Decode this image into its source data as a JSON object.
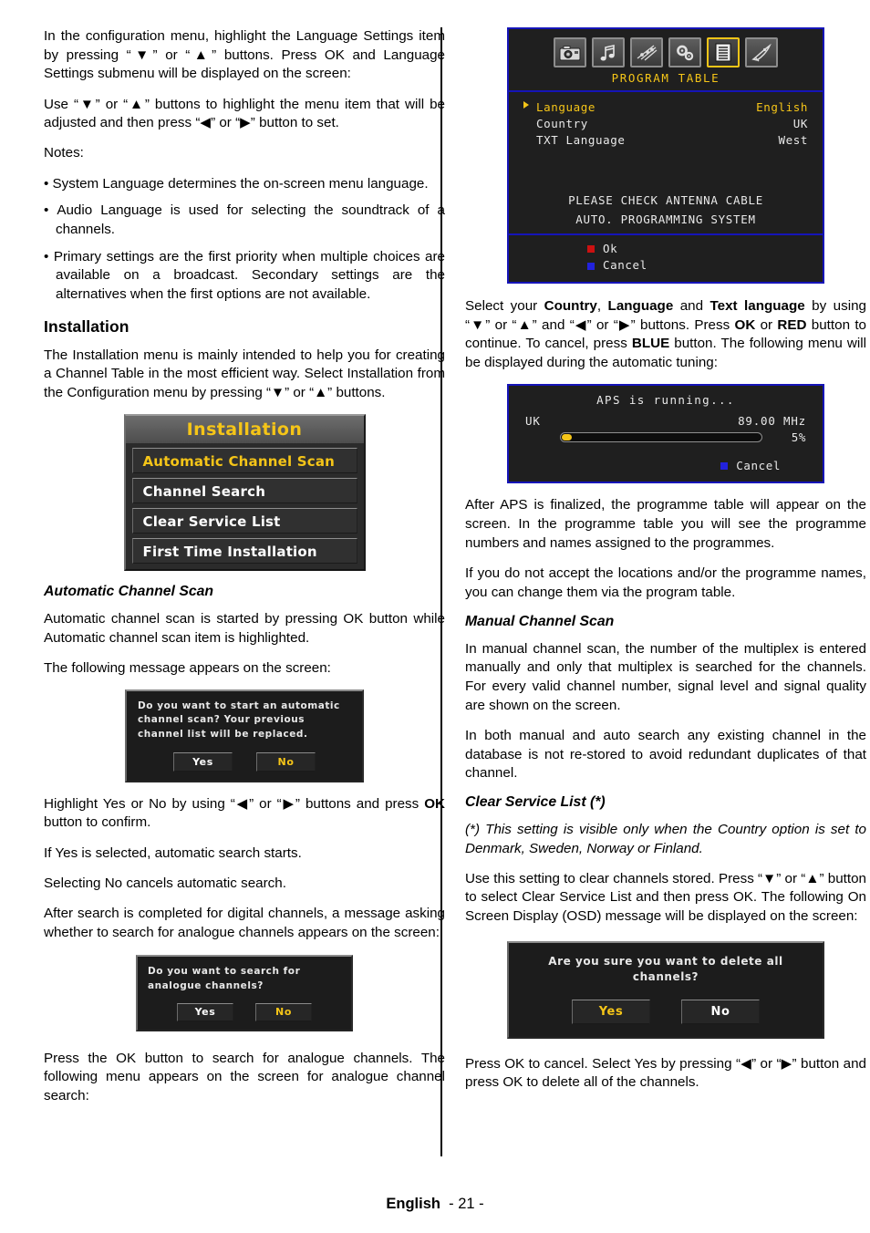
{
  "left_column": {
    "p1": "In the configuration menu, highlight the Language Settings item by pressing “▼” or “▲” buttons. Press OK and Language Settings submenu will be displayed on the screen:",
    "p2": "Use “▼” or “▲” buttons to highlight the menu item that will be adjusted and then press “◀” or “▶” button to set.",
    "notes_label": "Notes:",
    "notes": [
      "System Language determines the on-screen menu language.",
      "Audio Language is used for selecting the soundtrack of a channels.",
      "Primary settings are the first priority when multiple choices are available on a broadcast. Secondary settings are the alternatives when the first options are not available."
    ],
    "installation_heading": "Installation",
    "p3": "The Installation menu is mainly intended to help you for creating a Channel Table in the most efficient way. Select Installation from the Configuration menu by pressing “▼” or “▲” buttons.",
    "installation_menu": {
      "title": "Installation",
      "items": [
        {
          "label": "Automatic Channel Scan",
          "highlighted": true
        },
        {
          "label": "Channel Search",
          "highlighted": false
        },
        {
          "label": "Clear Service List",
          "highlighted": false
        },
        {
          "label": "First Time Installation",
          "highlighted": false
        }
      ]
    },
    "auto_scan_heading": "Automatic Channel Scan",
    "p4": "Automatic channel scan is started by pressing OK button while Automatic channel scan item is highlighted.",
    "p5": "The following message appears on the screen:",
    "dialog_auto_scan": {
      "message": "Do you want to start an automatic channel scan? Your previous channel list will be replaced.",
      "buttons": [
        {
          "label": "Yes",
          "highlighted": false
        },
        {
          "label": "No",
          "highlighted": true
        }
      ]
    },
    "p6_pre": "Highlight Yes or No by using “◀” or “▶” buttons and press ",
    "p6_bold": "OK",
    "p6_post": " button to confirm.",
    "p7": "If Yes is selected, automatic search starts.",
    "p8": "Selecting No cancels automatic search.",
    "p9": "After search is completed for digital channels, a message asking whether to search for analogue channels appears on the screen:",
    "dialog_analogue": {
      "message": "Do you want to search for analogue channels?",
      "buttons": [
        {
          "label": "Yes",
          "highlighted": false
        },
        {
          "label": "No",
          "highlighted": true
        }
      ]
    },
    "p10": "Press the OK button to search for analogue channels. The following menu appears on the screen for analogue channel search:"
  },
  "right_column": {
    "program_table_osd": {
      "tabs": [
        {
          "icon": "camera-icon",
          "active": false
        },
        {
          "icon": "music-note-icon",
          "active": false
        },
        {
          "icon": "feature-sliders-icon",
          "active": false
        },
        {
          "icon": "gears-icon",
          "active": false
        },
        {
          "icon": "list-document-icon",
          "active": true
        },
        {
          "icon": "install-rocket-icon",
          "active": false
        }
      ],
      "tab_label": "PROGRAM TABLE",
      "rows": [
        {
          "label": "Language",
          "value": "English",
          "highlighted": true
        },
        {
          "label": "Country",
          "value": "UK",
          "highlighted": false
        },
        {
          "label": "TXT Language",
          "value": "West",
          "highlighted": false
        }
      ],
      "notice_line1": "PLEASE CHECK ANTENNA CABLE",
      "notice_line2": "AUTO. PROGRAMMING SYSTEM",
      "footer_actions": [
        {
          "color": "#cc1111",
          "label": "Ok"
        },
        {
          "color": "#2222dd",
          "label": "Cancel"
        }
      ]
    },
    "p1_parts": {
      "a": "Select your ",
      "b1": "Country",
      "c": ", ",
      "b2": "Language",
      "d": " and ",
      "b3": "Text language",
      "e": " by using “▼” or “▲”  and  “◀” or “▶” buttons. Press ",
      "b4": "OK",
      "f": " or ",
      "b5": "RED",
      "g": " button to continue. To cancel, press ",
      "b6": "BLUE",
      "h": " button. The following menu will be displayed during the automatic tuning:"
    },
    "aps_osd": {
      "title": "APS is running...",
      "country": "UK",
      "frequency": "89.00 MHz",
      "percent": "5%",
      "progress_value": 5,
      "cancel_label": "Cancel",
      "cancel_color": "#2222dd"
    },
    "p2": "After APS is finalized, the programme table will appear on the screen. In the programme table you will see the programme numbers and names assigned to the programmes.",
    "p3": "If you do not accept the locations and/or the programme names, you can change them via the program table.",
    "manual_scan_heading": "Manual Channel Scan",
    "p4": "In manual channel scan, the number of the multiplex is entered manually and only that multiplex is searched for the channels. For every valid channel number, signal level and signal quality are shown on the screen.",
    "p5": "In both manual and auto search any existing channel in the database is not re-stored to avoid redundant duplicates of that channel.",
    "clear_service_heading": "Clear Service List (*)",
    "p6_italic": "(*) This setting is visible only when the Country option is set to Denmark, Sweden, Norway or Finland.",
    "p7": "Use this setting to clear channels stored. Press “▼” or “▲” button to select Clear Service List and then press OK. The following On Screen Display (OSD) message will be displayed on the screen:",
    "dialog_delete": {
      "message": "Are you sure you want to delete all channels?",
      "buttons": [
        {
          "label": "Yes",
          "highlighted": true
        },
        {
          "label": "No",
          "highlighted": false
        }
      ]
    },
    "p8": "Press OK to cancel. Select Yes by pressing “◀” or “▶” button and press OK to delete all of the channels."
  },
  "footer": {
    "language": "English",
    "page": "- 21 -"
  },
  "colors": {
    "osd_highlight": "#f5c518",
    "osd_border_blue": "#1514b8",
    "osd_background": "#1f1f1f",
    "red_key": "#cc1111",
    "blue_key": "#2222dd"
  }
}
